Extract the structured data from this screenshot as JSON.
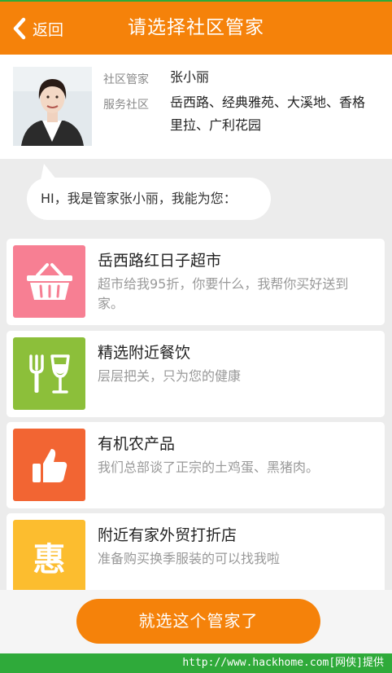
{
  "header": {
    "back_label": "返回",
    "title": "请选择社区管家"
  },
  "profile": {
    "manager_label": "社区管家",
    "manager_name": "张小丽",
    "community_label": "服务社区",
    "community_line1": "岳西路、经典雅苑、大溪地、香格",
    "community_line2": "里拉、广利花园"
  },
  "greeting": "HI，我是管家张小丽，我能为您：",
  "services": [
    {
      "title": "岳西路红日子超市",
      "desc": "超市给我95折，你要什么，我帮你买好送到家。",
      "icon": "shopping-basket-icon",
      "color": "#f77f93"
    },
    {
      "title": "精选附近餐饮",
      "desc": "层层把关，只为您的健康",
      "icon": "fork-wineglass-icon",
      "color": "#8cbf3a"
    },
    {
      "title": "有机农产品",
      "desc": "我们总部谈了正宗的土鸡蛋、黑猪肉。",
      "icon": "thumbs-up-icon",
      "color": "#f26533"
    },
    {
      "title": "附近有家外贸打折店",
      "desc": "准备购买换季服装的可以找我啦",
      "icon": "hui-discount-icon",
      "color": "#fcbd2f",
      "icon_text": "惠"
    }
  ],
  "cta_label": "就选这个管家了",
  "footer_text": "http://www.hackhome.com[网侠]提供",
  "colors": {
    "brand_orange": "#f5820a",
    "border_green": "#2faa3a"
  }
}
